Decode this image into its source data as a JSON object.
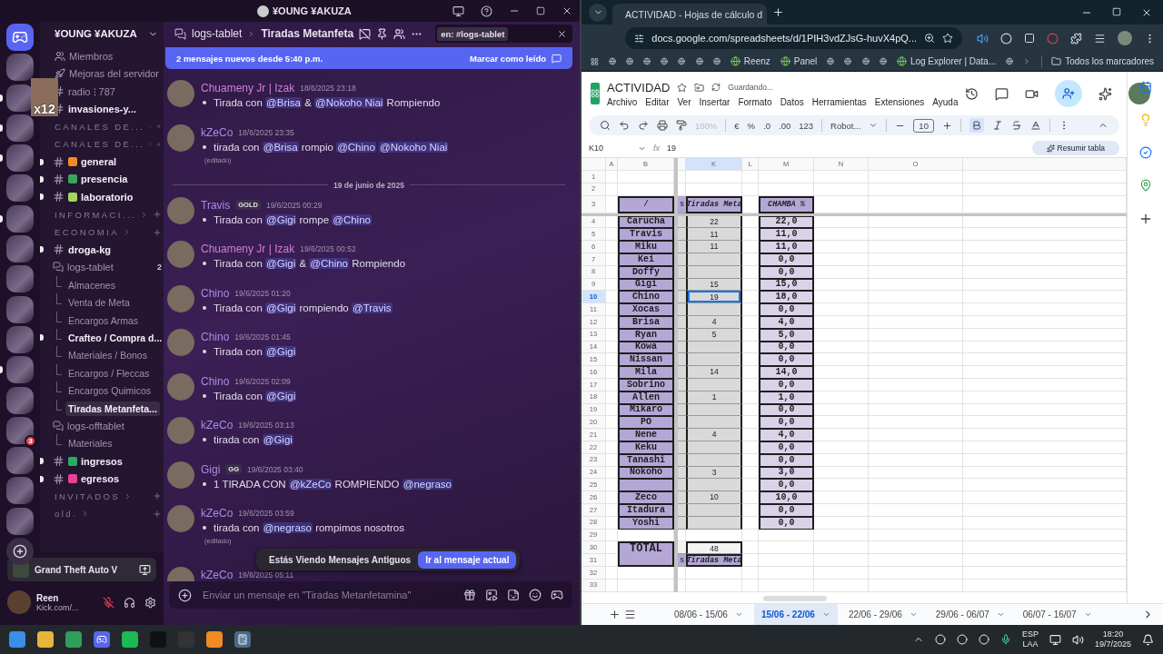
{
  "discord": {
    "window_title": "¥OUNG ¥AKUZA",
    "server_name": "¥OUNG ¥AKUZA",
    "overlay_count": "x12",
    "servers": [
      {
        "kind": "home",
        "unread": false
      },
      {
        "kind": "server",
        "unread": false
      },
      {
        "kind": "server",
        "unread": true
      },
      {
        "kind": "server",
        "unread": true
      },
      {
        "kind": "server",
        "unread": true
      },
      {
        "kind": "server",
        "unread": false
      },
      {
        "kind": "server",
        "unread": true
      },
      {
        "kind": "server",
        "unread": false
      },
      {
        "kind": "server",
        "unread": false
      },
      {
        "kind": "server",
        "unread": false
      },
      {
        "kind": "server",
        "unread": false
      },
      {
        "kind": "server",
        "unread": true
      },
      {
        "kind": "server",
        "unread": false
      },
      {
        "kind": "server",
        "unread": false,
        "badge": "3"
      },
      {
        "kind": "server",
        "unread": false
      },
      {
        "kind": "server",
        "unread": false
      },
      {
        "kind": "server",
        "unread": false
      },
      {
        "kind": "add",
        "unread": false
      }
    ],
    "channels": [
      {
        "kind": "link",
        "label": "Miembros"
      },
      {
        "kind": "link",
        "label": "Mejoras del servidor"
      },
      {
        "kind": "text",
        "label": "radio ⁝ 787",
        "unread": false
      },
      {
        "kind": "text",
        "label": "invasiones-y...",
        "unread": true
      },
      {
        "kind": "category",
        "label": "CANALES DE..."
      },
      {
        "kind": "category",
        "label": "CANALES DE..."
      },
      {
        "kind": "text",
        "label": "general",
        "unread": true,
        "color": "#f08a24"
      },
      {
        "kind": "text",
        "label": "presencia",
        "unread": true,
        "color": "#3ba55c"
      },
      {
        "kind": "text",
        "label": "laboratorio",
        "unread": true,
        "color": "#a4d65e"
      },
      {
        "kind": "category",
        "label": "INFORMACI..."
      },
      {
        "kind": "category",
        "label": "ECONOMIA"
      },
      {
        "kind": "text",
        "label": "droga-kg",
        "unread": true
      },
      {
        "kind": "forum",
        "label": "logs-tablet",
        "count": "2",
        "children": [
          {
            "label": "Almacenes",
            "unread": false,
            "selected": false
          },
          {
            "label": "Venta de Meta",
            "unread": false,
            "selected": false
          },
          {
            "label": "Encargos Armas",
            "unread": false,
            "selected": false
          },
          {
            "label": "Crafteo / Compra d...",
            "unread": true,
            "selected": false
          },
          {
            "label": "Materiales / Bonos",
            "unread": false,
            "selected": false
          },
          {
            "label": "Encargos / Fleccas",
            "unread": false,
            "selected": false
          },
          {
            "label": "Encargos Quimicos",
            "unread": false,
            "selected": false
          },
          {
            "label": "Tiradas Metanfeta...",
            "unread": false,
            "selected": true
          }
        ]
      },
      {
        "kind": "forum",
        "label": "logs-offtablet",
        "children": [
          {
            "label": "Materiales",
            "unread": false,
            "selected": false
          }
        ]
      },
      {
        "kind": "text",
        "label": "ingresos",
        "unread": true,
        "color": "#27ae60"
      },
      {
        "kind": "text",
        "label": "egresos",
        "unread": true,
        "color": "#e84393"
      },
      {
        "kind": "category",
        "label": "INVITADOS"
      },
      {
        "kind": "category",
        "label": "old."
      }
    ],
    "activity": {
      "game": "Grand Theft Auto V"
    },
    "user": {
      "name": "Reen",
      "status": "Kick.com/..."
    },
    "chat": {
      "breadcrumb": [
        "logs-tablet",
        "Tiradas Metanfeta"
      ],
      "search_chip": "en: #logs-tablet",
      "banner": {
        "text": "2 mensajes nuevos desde 5:40 p.m.",
        "action": "Marcar como leído"
      },
      "messages": [
        {
          "kind": "message",
          "author": "Chuameny Jr | Izak",
          "color": "#d07fd6",
          "time": "18/6/2025 23:18",
          "parts": [
            {
              "kind": "text",
              "text": "Tirada con "
            },
            {
              "kind": "mention",
              "text": "@Brisa"
            },
            {
              "kind": "text",
              "text": " & "
            },
            {
              "kind": "mention",
              "text": "@Nokoho Niai"
            },
            {
              "kind": "text",
              "text": " Rompiendo"
            }
          ]
        },
        {
          "kind": "message",
          "author": "kZeCo",
          "color": "#a68ce4",
          "time": "18/6/2025 23:35",
          "edited_note": "(editado)",
          "parts": [
            {
              "kind": "text",
              "text": "tirada con "
            },
            {
              "kind": "mention",
              "text": "@Brisa"
            },
            {
              "kind": "text",
              "text": " rompio "
            },
            {
              "kind": "mention",
              "text": "@Chino"
            },
            {
              "kind": "mention",
              "text": "@Nokoho Niai"
            }
          ]
        },
        {
          "kind": "divider",
          "label": "19 de junio de 2025"
        },
        {
          "kind": "message",
          "author": "Travis",
          "color": "#a68ce4",
          "tag": "GOLD",
          "time": "19/6/2025 00:29",
          "parts": [
            {
              "kind": "text",
              "text": "Tirada con "
            },
            {
              "kind": "mention",
              "text": "@Gigi"
            },
            {
              "kind": "text",
              "text": " rompe "
            },
            {
              "kind": "mention",
              "text": "@Chino"
            }
          ]
        },
        {
          "kind": "message",
          "author": "Chuameny Jr | Izak",
          "color": "#d07fd6",
          "time": "19/6/2025 00:52",
          "parts": [
            {
              "kind": "text",
              "text": "Tirada con "
            },
            {
              "kind": "mention",
              "text": "@Gigi"
            },
            {
              "kind": "text",
              "text": " & "
            },
            {
              "kind": "mention",
              "text": "@Chino"
            },
            {
              "kind": "text",
              "text": " Rompiendo"
            }
          ]
        },
        {
          "kind": "message",
          "author": "Chino",
          "color": "#a68ce4",
          "time": "19/6/2025 01:20",
          "parts": [
            {
              "kind": "text",
              "text": "Tirada con "
            },
            {
              "kind": "mention",
              "text": "@Gigi"
            },
            {
              "kind": "text",
              "text": " rompiendo "
            },
            {
              "kind": "mention",
              "text": "@Travis"
            }
          ]
        },
        {
          "kind": "message",
          "author": "Chino",
          "color": "#a68ce4",
          "time": "19/6/2025 01:45",
          "parts": [
            {
              "kind": "text",
              "text": "Tirada con "
            },
            {
              "kind": "mention",
              "text": "@Gigi"
            }
          ]
        },
        {
          "kind": "message",
          "author": "Chino",
          "color": "#a68ce4",
          "time": "19/6/2025 02:09",
          "parts": [
            {
              "kind": "text",
              "text": "Tirada con "
            },
            {
              "kind": "mention",
              "text": "@Gigi"
            }
          ]
        },
        {
          "kind": "message",
          "author": "kZeCo",
          "color": "#a68ce4",
          "time": "19/6/2025 03:13",
          "parts": [
            {
              "kind": "text",
              "text": "tirada con "
            },
            {
              "kind": "mention",
              "text": "@Gigi"
            }
          ]
        },
        {
          "kind": "message",
          "author": "Gigi",
          "color": "#a68ce4",
          "tag": "GG",
          "time": "19/6/2025 03:40",
          "parts": [
            {
              "kind": "text",
              "text": "1 TIRADA CON "
            },
            {
              "kind": "mention",
              "text": "@kZeCo"
            },
            {
              "kind": "text",
              "text": " ROMPIENDO "
            },
            {
              "kind": "mention",
              "text": "@negraso"
            }
          ]
        },
        {
          "kind": "message",
          "author": "kZeCo",
          "color": "#a68ce4",
          "time": "19/6/2025 03:59",
          "edited_note": "(editado)",
          "parts": [
            {
              "kind": "text",
              "text": "tirada con "
            },
            {
              "kind": "mention",
              "text": "@negraso"
            },
            {
              "kind": "text",
              "text": " rompimos nosotros"
            }
          ]
        },
        {
          "kind": "message",
          "author": "kZeCo",
          "color": "#a68ce4",
          "time": "19/6/2025 05:11"
        }
      ],
      "toast": {
        "text": "Estás Viendo Mensajes Antiguos",
        "button": "Ir al mensaje actual"
      },
      "composer": {
        "placeholder": "Enviar un mensaje en \"Tiradas Metanfetamina\""
      }
    }
  },
  "browser": {
    "tab_title": "ACTIVIDAD - Hojas de cálculo d",
    "url": "docs.google.com/spreadsheets/d/1PIH3vdZJsG-huvX4pQ...",
    "bookmarks": [
      {
        "kind": "icon"
      },
      {
        "kind": "icon"
      },
      {
        "kind": "icon"
      },
      {
        "kind": "icon"
      },
      {
        "kind": "icon"
      },
      {
        "kind": "icon"
      },
      {
        "kind": "icon"
      },
      {
        "kind": "labeled",
        "label": "Reenz"
      },
      {
        "kind": "labeled",
        "label": "Panel"
      },
      {
        "kind": "icon"
      },
      {
        "kind": "icon"
      },
      {
        "kind": "icon"
      },
      {
        "kind": "icon"
      },
      {
        "kind": "labeled",
        "label": "Log Explorer | Data..."
      },
      {
        "kind": "icon"
      }
    ],
    "all_bookmarks": "Todos los marcadores"
  },
  "sheets": {
    "title": "ACTIVIDAD",
    "save_status": "Guardando...",
    "menu": [
      "Archivo",
      "Editar",
      "Ver",
      "Insertar",
      "Formato",
      "Datos",
      "Herramientas",
      "Extensiones",
      "Ayuda"
    ],
    "zoom": "100%",
    "currency": "€",
    "percent": "%",
    "decrease_decimals": ".0",
    "increase_decimals": ".00",
    "number_format": "123",
    "font": "Robot...",
    "font_size": "10",
    "bold_active": true,
    "cell_ref": "K10",
    "fx_label": "fx",
    "formula": "19",
    "summarize": "Resumir tabla",
    "columns": [
      {
        "label": "A",
        "selected": false
      },
      {
        "label": "B",
        "selected": false
      },
      {
        "label": "K",
        "selected": true
      },
      {
        "label": "L",
        "selected": false
      },
      {
        "label": "M",
        "selected": false
      },
      {
        "label": "N",
        "selected": false
      },
      {
        "label": "O",
        "selected": false
      }
    ],
    "rows": [
      {
        "number": "1",
        "kind": "blank",
        "selected": false
      },
      {
        "number": "2",
        "kind": "blank",
        "selected": false
      },
      {
        "number": "3",
        "kind": "header",
        "selected": false,
        "name": "/",
        "cut": "s",
        "tiradas": "Tiradas Meta",
        "chamba": "CHAMBA %"
      },
      {
        "number": "4",
        "kind": "data",
        "selected": false,
        "name": "Carucha",
        "tiradas": "22",
        "chamba": "22,0"
      },
      {
        "number": "5",
        "kind": "data",
        "selected": false,
        "name": "Travis",
        "tiradas": "11",
        "chamba": "11,0"
      },
      {
        "number": "6",
        "kind": "data",
        "selected": false,
        "name": "Miku",
        "tiradas": "11",
        "chamba": "11,0"
      },
      {
        "number": "7",
        "kind": "data",
        "selected": false,
        "name": "Kei",
        "chamba": "0,0"
      },
      {
        "number": "8",
        "kind": "data",
        "selected": false,
        "name": "Doffy",
        "chamba": "0,0"
      },
      {
        "number": "9",
        "kind": "data",
        "selected": false,
        "name": "Gigi",
        "tiradas": "15",
        "chamba": "15,0"
      },
      {
        "number": "10",
        "kind": "data",
        "selected": true,
        "name": "Chino",
        "tiradas": "19",
        "chamba": "18,0"
      },
      {
        "number": "11",
        "kind": "data",
        "selected": false,
        "name": "Xocas",
        "chamba": "0,0"
      },
      {
        "number": "12",
        "kind": "data",
        "selected": false,
        "name": "Brisa",
        "tiradas": "4",
        "chamba": "4,0"
      },
      {
        "number": "13",
        "kind": "data",
        "selected": false,
        "name": "Ryan",
        "tiradas": "5",
        "chamba": "5,0"
      },
      {
        "number": "14",
        "kind": "data",
        "selected": false,
        "name": "Kowa",
        "chamba": "0,0"
      },
      {
        "number": "15",
        "kind": "data",
        "selected": false,
        "name": "Nissan",
        "chamba": "0,0"
      },
      {
        "number": "16",
        "kind": "data",
        "selected": false,
        "name": "Mila",
        "tiradas": "14",
        "chamba": "14,0"
      },
      {
        "number": "17",
        "kind": "data",
        "selected": false,
        "name": "Sobrino",
        "chamba": "0,0"
      },
      {
        "number": "18",
        "kind": "data",
        "selected": false,
        "name": "Allen",
        "tiradas": "1",
        "chamba": "1,0"
      },
      {
        "number": "19",
        "kind": "data",
        "selected": false,
        "name": "Mikaro",
        "chamba": "0,0"
      },
      {
        "number": "20",
        "kind": "data",
        "selected": false,
        "name": "PO",
        "chamba": "0,0"
      },
      {
        "number": "21",
        "kind": "data",
        "selected": false,
        "name": "Nene",
        "tiradas": "4",
        "chamba": "4,0"
      },
      {
        "number": "22",
        "kind": "data",
        "selected": false,
        "name": "Keku",
        "chamba": "0,0"
      },
      {
        "number": "23",
        "kind": "data",
        "selected": false,
        "name": "Tanashi",
        "chamba": "0,0"
      },
      {
        "number": "24",
        "kind": "data",
        "selected": false,
        "name": "Nokoho",
        "tiradas": "3",
        "chamba": "3,0"
      },
      {
        "number": "25",
        "kind": "data",
        "selected": false,
        "chamba": "0,0"
      },
      {
        "number": "26",
        "kind": "data",
        "selected": false,
        "name": "Zeco",
        "tiradas": "10",
        "chamba": "10,0"
      },
      {
        "number": "27",
        "kind": "data",
        "selected": false,
        "name": "Itadura",
        "chamba": "0,0"
      },
      {
        "number": "28",
        "kind": "data",
        "selected": false,
        "name": "Yoshi",
        "chamba": "0,0"
      },
      {
        "number": "29",
        "kind": "blank",
        "selected": false
      },
      {
        "number": "30",
        "kind": "total",
        "selected": false,
        "name": "TOTAL",
        "tiradas": "48"
      },
      {
        "number": "31",
        "kind": "footer",
        "selected": false,
        "cut": "s",
        "tiradas": "Tiradas Meta"
      },
      {
        "number": "32",
        "kind": "blank",
        "selected": false
      },
      {
        "number": "33",
        "kind": "blank",
        "selected": false
      }
    ],
    "sheet_tabs": [
      {
        "label": "08/06 - 15/06",
        "selected": false
      },
      {
        "label": "15/06 - 22/06",
        "selected": true
      },
      {
        "label": "22/06 - 29/06",
        "selected": false
      },
      {
        "label": "29/06 - 06/07",
        "selected": false
      },
      {
        "label": "06/07 - 16/07",
        "selected": false
      }
    ]
  },
  "taskbar": {
    "language": "ESP",
    "layout": "LAA",
    "time": "18:20",
    "date": "19/7/2025"
  }
}
